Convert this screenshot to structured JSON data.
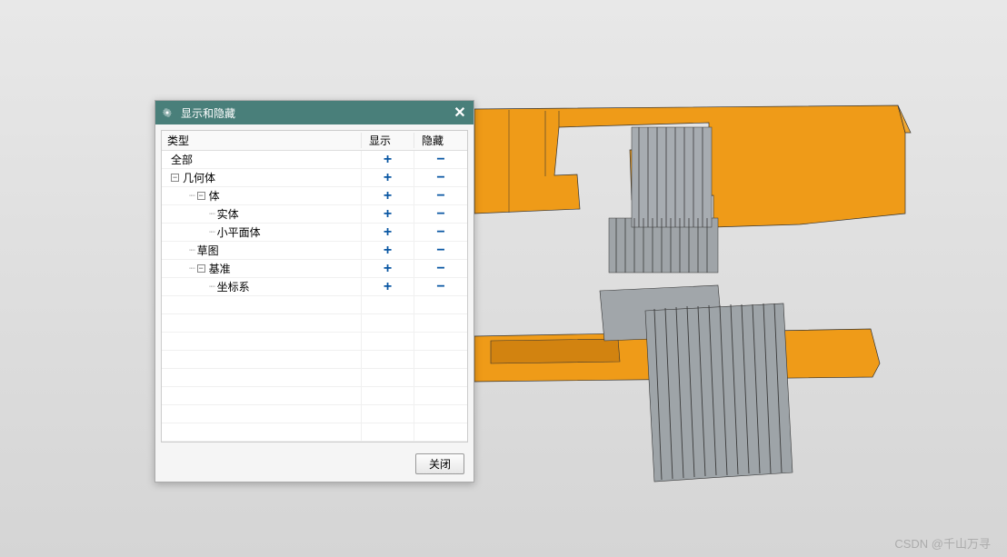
{
  "dialog": {
    "title": "显示和隐藏",
    "close_button": "✕",
    "columns": {
      "type": "类型",
      "show": "显示",
      "hide": "隐藏"
    },
    "rows": [
      {
        "indent": 0,
        "expander": null,
        "twig": "",
        "label": "全部",
        "show": "+",
        "hide": "−"
      },
      {
        "indent": 0,
        "expander": "−",
        "twig": "",
        "label": "几何体",
        "show": "+",
        "hide": "−"
      },
      {
        "indent": 1,
        "expander": "−",
        "twig": "",
        "label": "体",
        "show": "+",
        "hide": "−"
      },
      {
        "indent": 2,
        "expander": null,
        "twig": "",
        "label": "实体",
        "show": "+",
        "hide": "−"
      },
      {
        "indent": 2,
        "expander": null,
        "twig": "",
        "label": "小平面体",
        "show": "+",
        "hide": "−"
      },
      {
        "indent": 1,
        "expander": null,
        "twig": "",
        "label": "草图",
        "show": "+",
        "hide": "−"
      },
      {
        "indent": 1,
        "expander": "−",
        "twig": "",
        "label": "基准",
        "show": "+",
        "hide": "−"
      },
      {
        "indent": 2,
        "expander": null,
        "twig": "",
        "label": "坐标系",
        "show": "+",
        "hide": "−"
      }
    ],
    "empty_rows": 8,
    "close_label": "关闭"
  },
  "watermark": "CSDN @千山万寻"
}
